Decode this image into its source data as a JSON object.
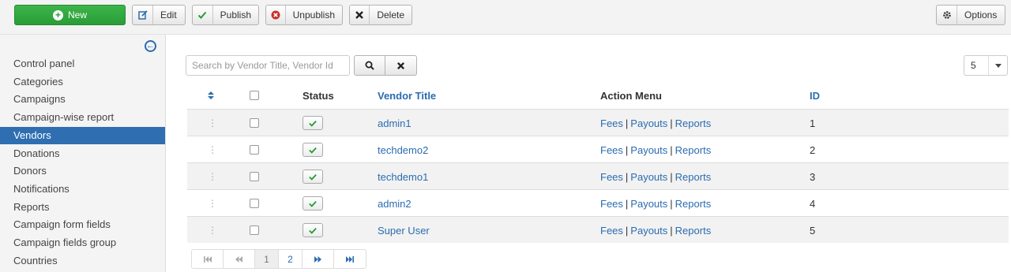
{
  "toolbar": {
    "new_label": "New",
    "edit_label": "Edit",
    "publish_label": "Publish",
    "unpublish_label": "Unpublish",
    "delete_label": "Delete",
    "options_label": "Options"
  },
  "sidebar": {
    "items": [
      {
        "label": "Control panel",
        "active": false
      },
      {
        "label": "Categories",
        "active": false
      },
      {
        "label": "Campaigns",
        "active": false
      },
      {
        "label": "Campaign-wise report",
        "active": false
      },
      {
        "label": "Vendors",
        "active": true
      },
      {
        "label": "Donations",
        "active": false
      },
      {
        "label": "Donors",
        "active": false
      },
      {
        "label": "Notifications",
        "active": false
      },
      {
        "label": "Reports",
        "active": false
      },
      {
        "label": "Campaign form fields",
        "active": false
      },
      {
        "label": "Campaign fields group",
        "active": false
      },
      {
        "label": "Countries",
        "active": false
      }
    ]
  },
  "search": {
    "placeholder": "Search by Vendor Title, Vendor Id",
    "value": ""
  },
  "list_limit": "5",
  "table": {
    "headers": {
      "status": "Status",
      "vendor_title": "Vendor Title",
      "action_menu": "Action Menu",
      "id": "ID"
    },
    "rows": [
      {
        "title": "admin1",
        "fees": "Fees",
        "payouts": "Payouts",
        "reports": "Reports",
        "id": "1"
      },
      {
        "title": "techdemo2",
        "fees": "Fees",
        "payouts": "Payouts",
        "reports": "Reports",
        "id": "2"
      },
      {
        "title": "techdemo1",
        "fees": "Fees",
        "payouts": "Payouts",
        "reports": "Reports",
        "id": "3"
      },
      {
        "title": "admin2",
        "fees": "Fees",
        "payouts": "Payouts",
        "reports": "Reports",
        "id": "4"
      },
      {
        "title": "Super User",
        "fees": "Fees",
        "payouts": "Payouts",
        "reports": "Reports",
        "id": "5"
      }
    ],
    "separator": "|"
  },
  "pagination": {
    "pages": [
      "1",
      "2"
    ],
    "current": "1"
  },
  "colors": {
    "accent": "#2b6cb0",
    "new_button": "#2a9c37",
    "active_sidebar": "#2f6eb1",
    "publish_check": "#2a9c37",
    "unpublish_icon": "#c9302c"
  }
}
